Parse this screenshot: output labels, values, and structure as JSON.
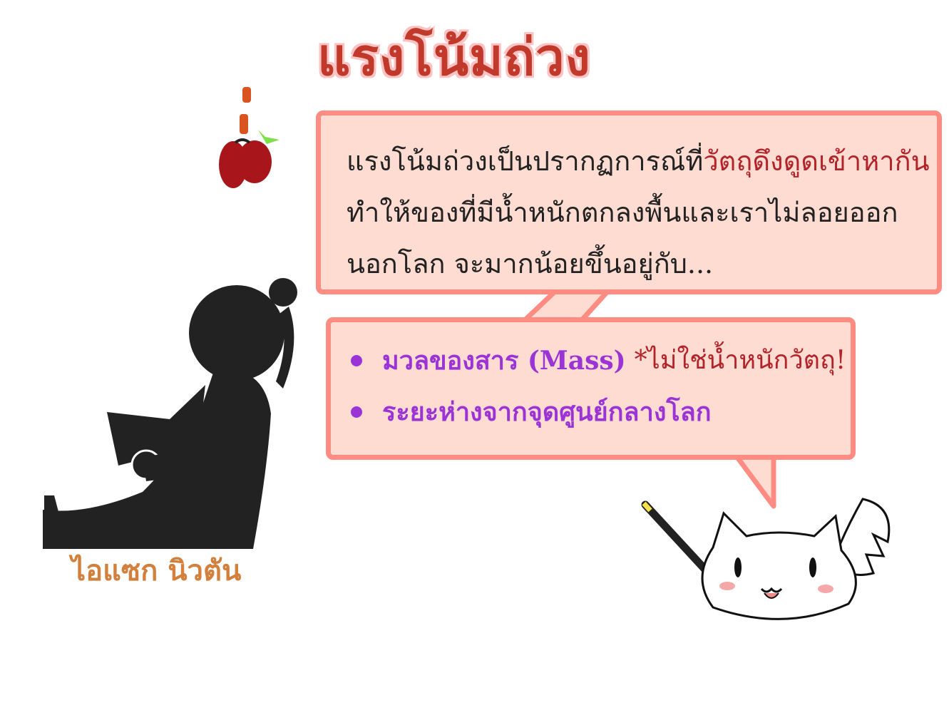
{
  "title": "แรงโน้มถ่วง",
  "intro": {
    "line1_prefix": "แรงโน้มถ่วงเป็นปรากฏการณ์ที่",
    "line1_highlight": "วัตถุดึงดูดเข้าหากัน",
    "line2": "ทำให้ของที่มีน้ำหนักตกลงพื้นและเราไม่ลอยออก",
    "line3": "นอกโลก จะมากน้อยขึ้นอยู่กับ..."
  },
  "factors": [
    {
      "label": "มวลของสาร (Mass)",
      "note": "*ไม่ใช่น้ำหนักวัตถุ!"
    },
    {
      "label": "ระยะห่างจากจุดศูนย์กลางโลก",
      "note": ""
    }
  ],
  "caption": "ไอแซก นิวตัน",
  "colors": {
    "title": "#c0392b",
    "bubble_fill": "#ffdcd2",
    "bubble_border": "#ff8c83",
    "highlight": "#b2242a",
    "bullet": "#9b34d4",
    "caption": "#d2803c",
    "silhouette": "#222222",
    "apple": "#a8161c"
  },
  "icons": [
    "apple-icon",
    "newton-silhouette",
    "cat-mascot"
  ]
}
